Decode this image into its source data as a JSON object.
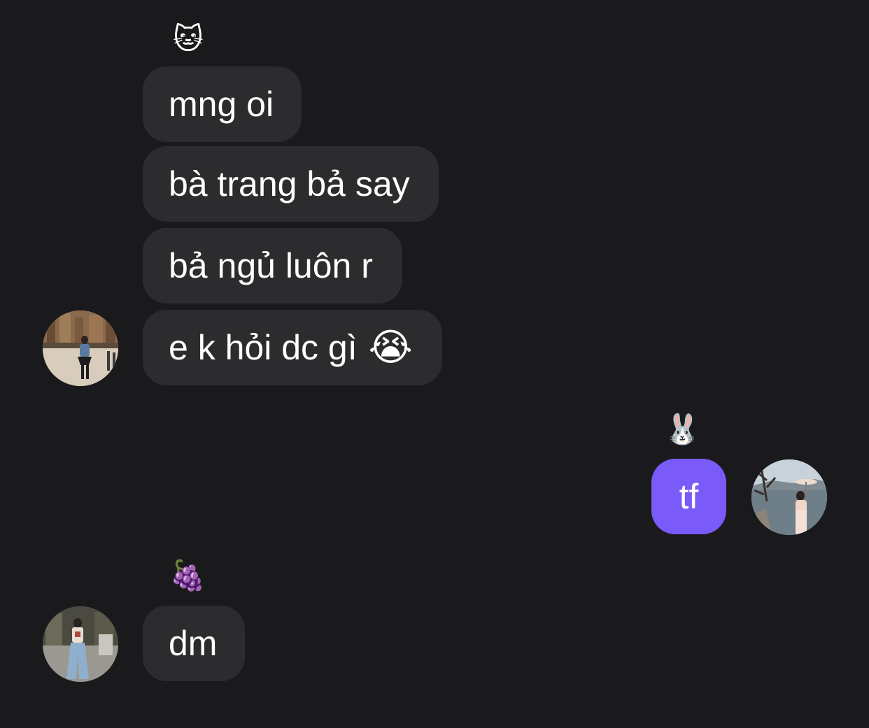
{
  "thread": {
    "group1": {
      "nickname_emoji": "🐱",
      "messages": [
        {
          "text": "mng oi"
        },
        {
          "text": "bà trang bả say"
        },
        {
          "text": "bả ngủ luôn r"
        },
        {
          "text": "e k hỏi dc gì",
          "emoji": "😭"
        }
      ],
      "avatar": "sender-avatar-street-photo"
    },
    "group2": {
      "nickname_emoji": "🐰",
      "messages": [
        {
          "text": "tf"
        }
      ],
      "avatar": "self-avatar-lake-photo",
      "bubble_color": "#7a5af8"
    },
    "group3": {
      "nickname_emoji": "🍇",
      "messages": [
        {
          "text": "dm"
        }
      ],
      "avatar": "sender-avatar-store-photo"
    }
  },
  "colors": {
    "background": "#1a1a1d",
    "incoming_bubble": "#2c2c2f",
    "outgoing_bubble": "#7a5af8",
    "text": "#ffffff"
  }
}
